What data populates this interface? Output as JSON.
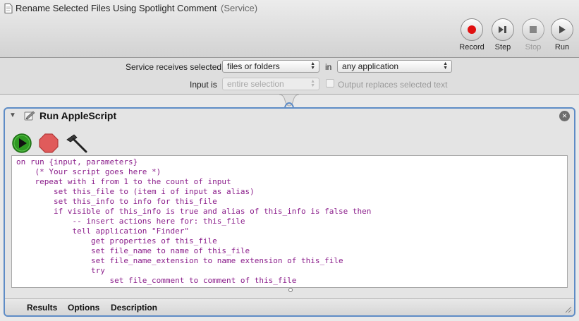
{
  "window": {
    "title": "Rename Selected Files Using Spotlight Comment",
    "subtitle": "(Service)"
  },
  "toolbar": {
    "record_label": "Record",
    "step_label": "Step",
    "stop_label": "Stop",
    "run_label": "Run"
  },
  "service": {
    "receives_label": "Service receives selected",
    "type_value": "files or folders",
    "in_label": "in",
    "app_value": "any application",
    "input_is_label": "Input is",
    "input_value": "entire selection",
    "output_replaces_label": "Output replaces selected text",
    "output_replaces_checked": false
  },
  "action": {
    "title": "Run AppleScript",
    "code_lines": [
      "on run {input, parameters}",
      "    (* Your script goes here *)",
      "    repeat with i from 1 to the count of input",
      "        set this_file to (item i of input as alias)",
      "        set this_info to info for this_file",
      "        if visible of this_info is true and alias of this_info is false then",
      "            -- insert actions here for: this_file",
      "            tell application \"Finder\"",
      "                get properties of this_file",
      "                set file_name to name of this_file",
      "                set file_name_extension to name extension of this_file",
      "                try",
      "                    set file_comment to comment of this_file"
    ]
  },
  "footer": {
    "results_label": "Results",
    "options_label": "Options",
    "description_label": "Description"
  },
  "colors": {
    "accent_border": "#5e8cc6",
    "code_text": "#8b1e8b",
    "record_red": "#e01010",
    "run_green": "#2e9a22",
    "stop_red": "#e05b5b"
  }
}
